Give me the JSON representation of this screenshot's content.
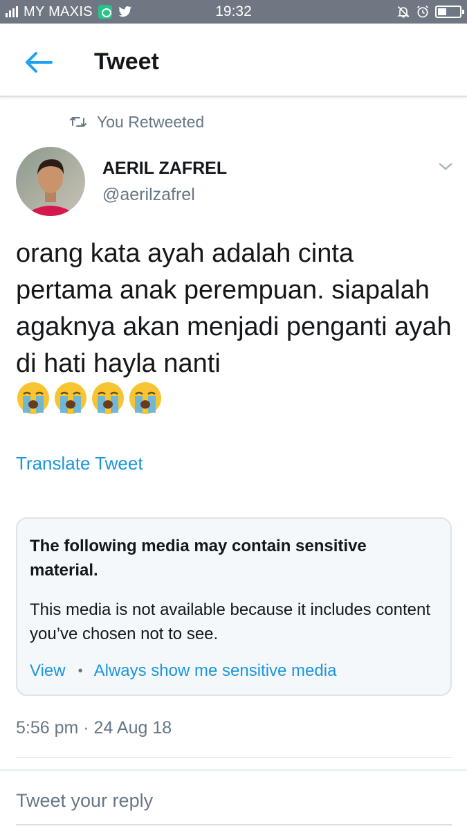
{
  "status_bar": {
    "carrier": "MY MAXIS",
    "time": "19:32",
    "icons": [
      "signal-icon",
      "chat-app-icon",
      "twitter-bird-icon",
      "mute-icon",
      "alarm-icon",
      "battery-icon"
    ]
  },
  "header": {
    "title": "Tweet",
    "back_icon": "back-arrow-icon"
  },
  "retweet": {
    "label": "You Retweeted",
    "icon": "retweet-icon"
  },
  "author": {
    "name": "AERIL ZAFREL",
    "handle": "@aerilzafrel"
  },
  "tweet": {
    "text": "orang kata ayah adalah cinta pertama anak perempuan. siapalah agaknya akan menjadi penganti ayah di hati hayla nanti",
    "emojis": [
      "loudly-crying-face",
      "loudly-crying-face",
      "loudly-crying-face",
      "loudly-crying-face"
    ],
    "translate_label": "Translate Tweet"
  },
  "sensitive_card": {
    "title": "The following media may contain sensitive material.",
    "body": "This media is not available because it includes content you’ve chosen not to see.",
    "view_label": "View",
    "separator": "•",
    "always_show_label": "Always show me sensitive media"
  },
  "timestamp": "5:56 pm · 24 Aug 18",
  "reply": {
    "placeholder": "Tweet your reply"
  },
  "colors": {
    "accent": "#1b95e0",
    "secondary_text": "#657786",
    "status_bar": "#6f7882",
    "card_bg": "#f5f8fa"
  }
}
